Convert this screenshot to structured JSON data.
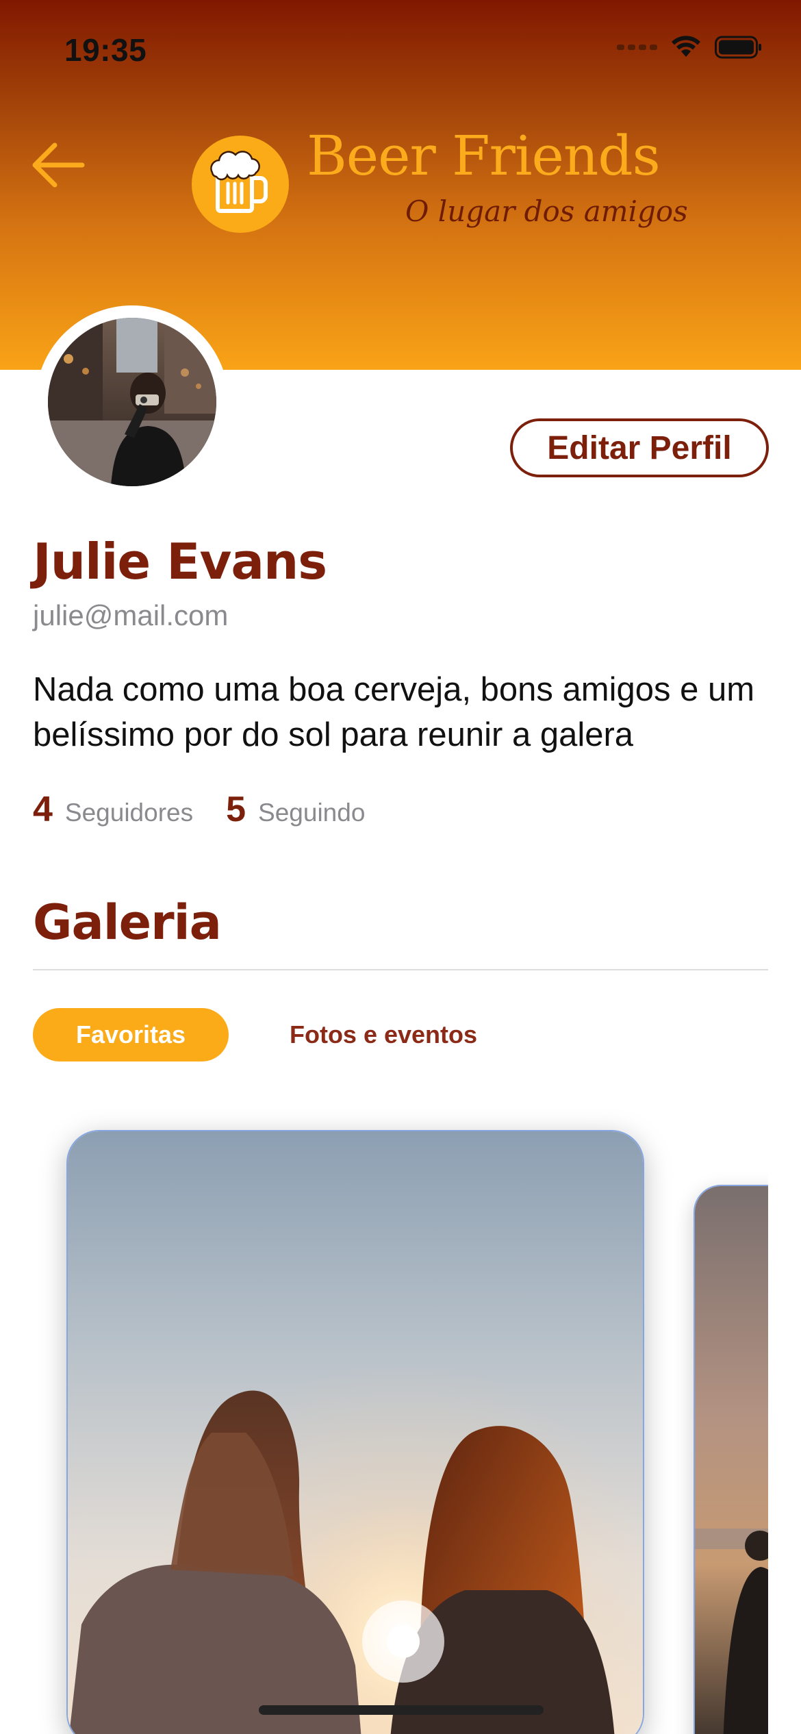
{
  "status_bar": {
    "time": "19:35",
    "icons": [
      "signal-icon",
      "wifi-icon",
      "battery-icon"
    ]
  },
  "nav": {
    "back_icon": "arrow-left-icon",
    "logo_icon": "beer-mug-icon"
  },
  "brand": {
    "title": "Beer Friends",
    "subtitle": "O lugar dos amigos"
  },
  "profile": {
    "name": "Julie Evans",
    "email": "julie@mail.com",
    "bio": "Nada como uma boa cerveja, bons amigos e um belíssimo por do sol para reunir a galera",
    "edit_label": "Editar Perfil",
    "followers_count": "4",
    "followers_label": "Seguidores",
    "following_count": "5",
    "following_label": "Seguindo"
  },
  "gallery": {
    "title": "Galeria",
    "tabs": [
      {
        "label": "Favoritas",
        "active": true
      },
      {
        "label": "Fotos e eventos",
        "active": false
      }
    ]
  },
  "colors": {
    "brand_dark": "#7c1f0b",
    "accent": "#fbab17",
    "header_top": "#801800",
    "header_bottom": "#f9a317",
    "muted_text": "#8a8a8e"
  }
}
